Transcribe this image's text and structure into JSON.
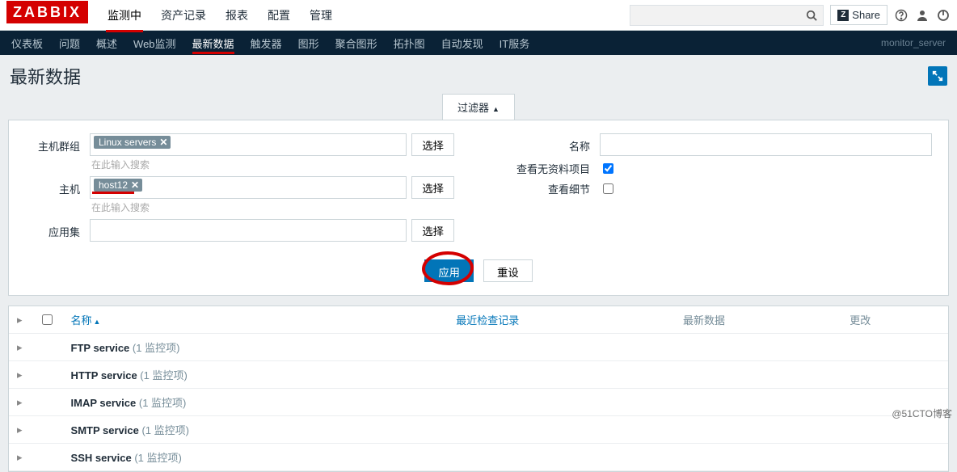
{
  "app": {
    "logo": "ZABBIX"
  },
  "topnav": {
    "items": [
      {
        "label": "监测中",
        "active": true
      },
      {
        "label": "资产记录"
      },
      {
        "label": "报表"
      },
      {
        "label": "配置"
      },
      {
        "label": "管理"
      }
    ]
  },
  "search": {
    "placeholder": ""
  },
  "share": {
    "label": "Share",
    "icon_prefix": "Z"
  },
  "subnav": {
    "items": [
      {
        "label": "仪表板"
      },
      {
        "label": "问题"
      },
      {
        "label": "概述"
      },
      {
        "label": "Web监测"
      },
      {
        "label": "最新数据",
        "active": true
      },
      {
        "label": "触发器"
      },
      {
        "label": "图形"
      },
      {
        "label": "聚合图形"
      },
      {
        "label": "拓扑图"
      },
      {
        "label": "自动发现"
      },
      {
        "label": "IT服务"
      }
    ],
    "server_label": "monitor_server"
  },
  "page": {
    "title": "最新数据"
  },
  "filter": {
    "tab_label": "过滤器",
    "labels": {
      "host_groups": "主机群组",
      "hosts": "主机",
      "application": "应用集",
      "name": "名称",
      "show_empty": "查看无资料项目",
      "show_details": "查看细节"
    },
    "host_groups": {
      "tags": [
        "Linux servers"
      ],
      "placeholder": "在此输入搜索"
    },
    "hosts": {
      "tags": [
        "host12"
      ],
      "placeholder": "在此输入搜索"
    },
    "application": {
      "value": ""
    },
    "name": {
      "value": ""
    },
    "show_empty": true,
    "show_details": false,
    "select_btn": "选择",
    "apply_btn": "应用",
    "reset_btn": "重设"
  },
  "table": {
    "columns": {
      "name": "名称",
      "last_check": "最近检查记录",
      "last_data": "最新数据",
      "change": "更改"
    },
    "rows": [
      {
        "name": "FTP service",
        "count_text": "(1 监控项)"
      },
      {
        "name": "HTTP service",
        "count_text": "(1 监控项)"
      },
      {
        "name": "IMAP service",
        "count_text": "(1 监控项)"
      },
      {
        "name": "SMTP service",
        "count_text": "(1 监控项)"
      },
      {
        "name": "SSH service",
        "count_text": "(1 监控项)"
      }
    ]
  },
  "watermark": "@51CTO博客"
}
